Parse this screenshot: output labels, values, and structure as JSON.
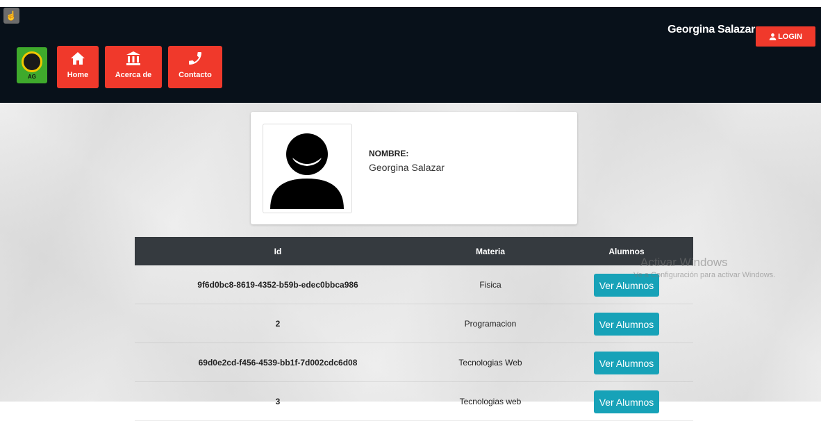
{
  "header": {
    "user_name": "Georgina Salazar",
    "login_label": "LOGIN"
  },
  "nav": {
    "logo_text": "AG",
    "items": [
      {
        "label": "Home",
        "icon": "home-icon"
      },
      {
        "label": "Acerca de",
        "icon": "bank-icon"
      },
      {
        "label": "Contacto",
        "icon": "phone-icon"
      }
    ]
  },
  "profile": {
    "label": "NOMBRE:",
    "name": "Georgina Salazar"
  },
  "table": {
    "headers": [
      "Id",
      "Materia",
      "Alumnos"
    ],
    "rows": [
      {
        "id": "9f6d0bc8-8619-4352-b59b-edec0bbca986",
        "materia": "Fisica",
        "action": "Ver Alumnos"
      },
      {
        "id": "2",
        "materia": "Programacion",
        "action": "Ver Alumnos"
      },
      {
        "id": "69d0e2cd-f456-4539-bb1f-7d002cdc6d08",
        "materia": "Tecnologias Web",
        "action": "Ver Alumnos"
      },
      {
        "id": "3",
        "materia": "Tecnologias web",
        "action": "Ver Alumnos"
      }
    ]
  },
  "watermark": {
    "line1": "Activar Windows",
    "line2": "Ve a Configuración para activar Windows."
  },
  "colors": {
    "nav_red": "#f0392b",
    "topbar": "#08111a",
    "table_header": "#353a3f",
    "button_teal": "#17a2b8"
  }
}
